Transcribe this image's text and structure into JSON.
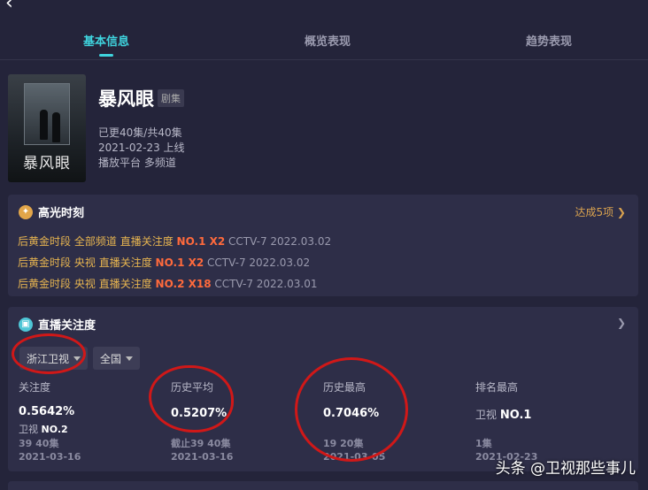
{
  "nav": {
    "back_icon": "chevron-left-icon",
    "tabs": [
      {
        "label": "基本信息",
        "active": true
      },
      {
        "label": "概览表现",
        "active": false
      },
      {
        "label": "趋势表现",
        "active": false
      }
    ]
  },
  "show": {
    "poster_title": "暴风眼",
    "title": "暴风眼",
    "tag": "剧集",
    "episodes": "已更40集/共40集",
    "premiere": "2021-02-23 上线",
    "platform": "播放平台 多频道"
  },
  "highlights": {
    "title": "高光时刻",
    "icon": "lightbulb-icon",
    "more": "达成5项 ❯",
    "rows": [
      {
        "slot": "后黄金时段",
        "scope": "全部频道",
        "metric": "直播关注度",
        "rank": "NO.1 X2",
        "channel": "CCTV-7 2022.03.02"
      },
      {
        "slot": "后黄金时段",
        "scope": "央视",
        "metric": "直播关注度",
        "rank": "NO.1 X2",
        "channel": "CCTV-7 2022.03.02"
      },
      {
        "slot": "后黄金时段",
        "scope": "央视",
        "metric": "直播关注度",
        "rank": "NO.2 X18",
        "channel": "CCTV-7 2022.03.01"
      }
    ]
  },
  "attention": {
    "title": "直播关注度",
    "icon": "tv-icon",
    "more": "❯",
    "filters": {
      "channel": "浙江卫视",
      "region": "全国"
    },
    "stats": [
      {
        "label": "关注度",
        "value": "0.5642%",
        "sub_prefix": "卫视",
        "sub_value": "NO.2",
        "foot1": "39 40集",
        "foot2": "2021-03-16"
      },
      {
        "label": "历史平均",
        "value": "0.5207%",
        "sub_prefix": "",
        "sub_value": "",
        "foot1": "截止39 40集",
        "foot2": "2021-03-16"
      },
      {
        "label": "历史最高",
        "value": "0.7046%",
        "sub_prefix": "",
        "sub_value": "",
        "foot1": "19 20集",
        "foot2": "2021-03-05"
      },
      {
        "label": "排名最高",
        "value": "",
        "sub_prefix": "卫视",
        "sub_value": "NO.1",
        "foot1": "1集",
        "foot2": "2021-02-23"
      }
    ]
  },
  "watermark": "头条 @卫视那些事儿",
  "colors": {
    "accent": "#3fd4de",
    "highlight_gold": "#e6b450",
    "highlight_orange": "#ff6a3c",
    "annotation_red": "#d01818",
    "background": "#24243a",
    "card": "#2e2e48"
  }
}
